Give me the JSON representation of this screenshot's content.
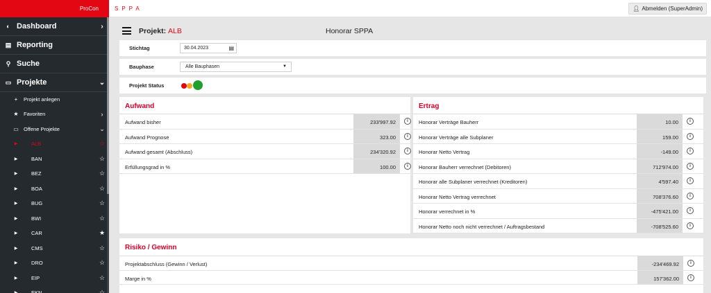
{
  "topbar": {
    "brand": "ProCon",
    "app_name": "SPPA",
    "logout_label": "Abmelden (SuperAdmin)",
    "logout_icon": "user-icon"
  },
  "sidebar": {
    "main_items": [
      {
        "label": "Dashboard",
        "icon": "dashboard-icon"
      },
      {
        "label": "Reporting",
        "icon": "document-icon"
      },
      {
        "label": "Suche",
        "icon": "search-icon"
      },
      {
        "label": "Projekte",
        "icon": "folder-icon"
      }
    ],
    "sub_items": [
      {
        "label": "Projekt anlegen",
        "icon": "plus-icon"
      },
      {
        "label": "Favoriten",
        "icon": "star-icon"
      },
      {
        "label": "Offene Projekte",
        "icon": "folder-open-icon"
      }
    ],
    "projects": [
      {
        "label": "ALB",
        "starred": false
      },
      {
        "label": "BAN",
        "starred": false
      },
      {
        "label": "BEZ",
        "starred": false
      },
      {
        "label": "BOA",
        "starred": false
      },
      {
        "label": "BUG",
        "starred": false
      },
      {
        "label": "BWI",
        "starred": false
      },
      {
        "label": "CAR",
        "starred": true
      },
      {
        "label": "CMS",
        "starred": false
      },
      {
        "label": "DRO",
        "starred": false
      },
      {
        "label": "EIP",
        "starred": false
      },
      {
        "label": "EKN",
        "starred": false
      }
    ],
    "active_project": "ALB"
  },
  "header": {
    "project_label": "Projekt:",
    "project_value": "ALB",
    "page_title": "Honorar SPPA"
  },
  "filters": {
    "stichtag_label": "Stichtag",
    "stichtag_value": "30.04.2023",
    "bauphase_label": "Bauphase",
    "bauphase_value": "Alle Bauphasen",
    "status_label": "Projekt Status",
    "status_colors": [
      "#e30613",
      "#f5a623",
      "#1fa02e"
    ],
    "status_active": "green"
  },
  "aufwand": {
    "title": "Aufwand",
    "rows": [
      {
        "label": "Aufwand bisher",
        "value": "233'997.92"
      },
      {
        "label": "Aufwand Prognose",
        "value": "323.00"
      },
      {
        "label": "Aufwand gesamt (Abschluss)",
        "value": "234'320.92"
      },
      {
        "label": "Erfüllungsgrad in %",
        "value": "100.00"
      }
    ]
  },
  "ertrag": {
    "title": "Ertrag",
    "rows": [
      {
        "label": "Honorar Verträge Bauherr",
        "value": "10.00"
      },
      {
        "label": "Honorar Verträge alle Subplaner",
        "value": "159.00"
      },
      {
        "label": "Honorar Netto Vertrag",
        "value": "-149.00"
      },
      {
        "label": "Honorar Bauherr verrechnet (Debitoren)",
        "value": "712'974.00"
      },
      {
        "label": "Honorar alle Subplaner verrechnet (Kreditoren)",
        "value": "4'597.40"
      },
      {
        "label": "Honorar Netto Vertrag verrechnet",
        "value": "708'376.60"
      },
      {
        "label": "Honorar verrechnet in %",
        "value": "-475'421.00"
      },
      {
        "label": "Honorar Netto noch nicht verrechnet / Auftragsbestand",
        "value": "-708'525.60"
      }
    ]
  },
  "risiko": {
    "title": "Risiko / Gewinn",
    "rows": [
      {
        "label": "Projektabschluss (Gewinn / Verlust)",
        "value": "-234'469.92"
      },
      {
        "label": "Marge in %",
        "value": "157'362.00"
      }
    ]
  },
  "colors": {
    "accent": "#e30613",
    "sidebar_bg": "#252a2f",
    "value_bg": "#dadada"
  }
}
